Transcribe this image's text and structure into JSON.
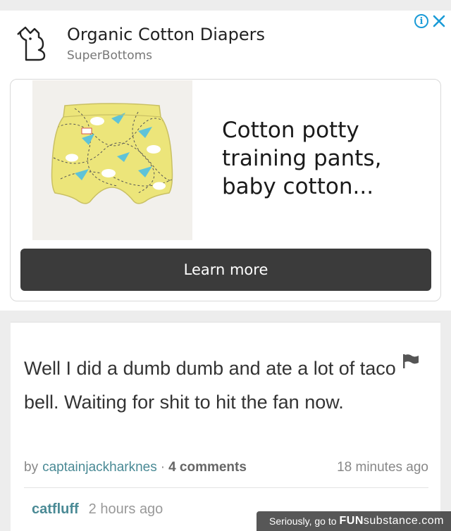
{
  "ad": {
    "title": "Organic Cotton Diapers",
    "advertiser": "SuperBottoms",
    "info_glyph": "i",
    "description": "Cotton potty training pants, baby cotton...",
    "cta_label": "Learn more",
    "product_image": "yellow-training-pants-with-paper-planes",
    "colors": {
      "cta_bg": "#3b3b3b",
      "info_blue": "#1a9bd7",
      "product_yellow": "#ece57a"
    }
  },
  "post": {
    "text": "Well I did a dumb dumb and ate a lot of taco bell. Waiting for shit to hit the fan now.",
    "by_label": "by",
    "author": "captainjackharknes",
    "separator": "·",
    "comments": "4 comments",
    "time_ago": "18 minutes ago",
    "flag_icon": "flag-icon"
  },
  "next_comment": {
    "author": "catfluff",
    "time_ago": "2 hours ago"
  },
  "watermark": {
    "prefix": "Seriously, go to",
    "brand_bold": "FUN",
    "brand_sub": "substance",
    "brand_tld": ".com"
  }
}
